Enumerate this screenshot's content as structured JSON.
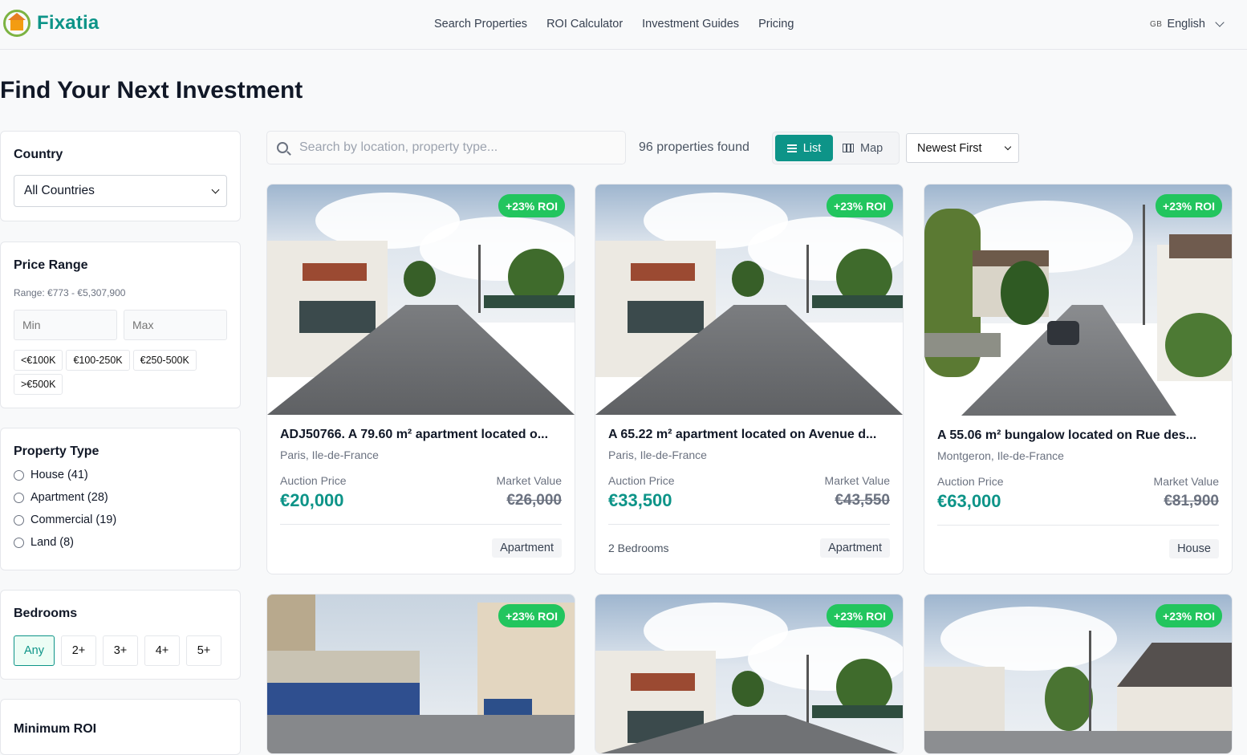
{
  "brand": {
    "name": "Fixatia"
  },
  "nav": [
    "Search Properties",
    "ROI Calculator",
    "Investment Guides",
    "Pricing"
  ],
  "language": {
    "flag": "GB",
    "label": "English"
  },
  "page_title": "Find Your Next Investment",
  "filters": {
    "country": {
      "title": "Country",
      "selected": "All Countries"
    },
    "price": {
      "title": "Price Range",
      "range_text": "Range: €773 - €5,307,900",
      "min_placeholder": "Min",
      "max_placeholder": "Max",
      "chips": [
        "<€100K",
        "€100-250K",
        "€250-500K",
        ">€500K"
      ]
    },
    "property_type": {
      "title": "Property Type",
      "options": [
        "House (41)",
        "Apartment (28)",
        "Commercial (19)",
        "Land (8)"
      ]
    },
    "bedrooms": {
      "title": "Bedrooms",
      "options": [
        "Any",
        "2+",
        "3+",
        "4+",
        "5+"
      ],
      "selected": "Any"
    },
    "min_roi": {
      "title": "Minimum ROI"
    }
  },
  "toolbar": {
    "search_placeholder": "Search by location, property type...",
    "count_text": "96 properties found",
    "list_label": "List",
    "map_label": "Map",
    "sort_selected": "Newest First"
  },
  "listing_labels": {
    "auction": "Auction Price",
    "market": "Market Value"
  },
  "listings": [
    {
      "roi": "+23% ROI",
      "title": "ADJ50766. A 79.60 m² apartment located o...",
      "location": "Paris, Ile-de-France",
      "auction": "€20,000",
      "market": "€26,000",
      "beds": "",
      "type": "Apartment"
    },
    {
      "roi": "+23% ROI",
      "title": "A 65.22 m² apartment located on Avenue d...",
      "location": "Paris, Ile-de-France",
      "auction": "€33,500",
      "market": "€43,550",
      "beds": "2 Bedrooms",
      "type": "Apartment"
    },
    {
      "roi": "+23% ROI",
      "title": "A 55.06 m² bungalow located on Rue des...",
      "location": "Montgeron, Ile-de-France",
      "auction": "€63,000",
      "market": "€81,900",
      "beds": "",
      "type": "House"
    },
    {
      "roi": "+23% ROI"
    },
    {
      "roi": "+23% ROI"
    },
    {
      "roi": "+23% ROI"
    }
  ],
  "colors": {
    "accent": "#0d9488",
    "roi_badge": "#22c55e"
  }
}
